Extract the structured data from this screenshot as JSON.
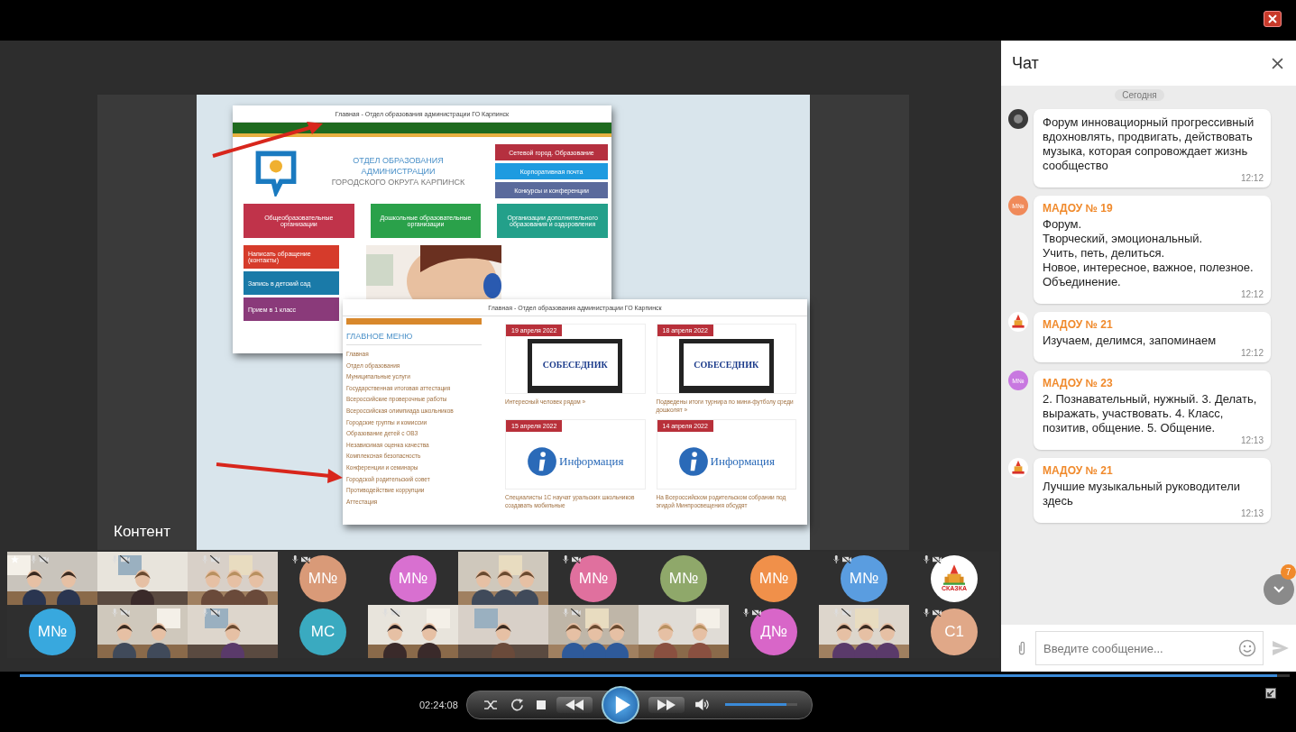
{
  "content_label": "Контент",
  "slide": {
    "back_window": {
      "title": "Главная - Отдел образования администрации ГО Карпинск",
      "heading": [
        "ОТДЕЛ ОБРАЗОВАНИЯ",
        "АДМИНИСТРАЦИИ",
        "ГОРОДСКОГО ОКРУГА КАРПИНСК"
      ],
      "side_links": [
        {
          "label": "Сетевой город. Образование",
          "color": "#b5303f"
        },
        {
          "label": "Корпоративная почта",
          "color": "#1e9be0"
        },
        {
          "label": "Конкурсы и конференции",
          "color": "#5a6a9c"
        }
      ],
      "tiles": [
        {
          "label": "Общеобразовательные организации",
          "color": "#c0334a"
        },
        {
          "label": "Дошкольные образовательные организации",
          "color": "#2aa14a"
        },
        {
          "label": "Организации дополнительного образования и оздоровления",
          "color": "#23a08a"
        }
      ],
      "left_links": [
        {
          "label": "Написать обращение (контакты)",
          "color": "#d63b2b"
        },
        {
          "label": "Запись в детский сад",
          "color": "#1a7aa8"
        },
        {
          "label": "Прием в 1 класс",
          "color": "#8a3a7a"
        }
      ]
    },
    "front_window": {
      "title": "Главная - Отдел образования администрации ГО Карпинск",
      "menu_title": "ГЛАВНОЕ МЕНЮ",
      "menu": [
        "Главная",
        "Отдел образования",
        "Муниципальные услуги",
        "Государственная итоговая аттестация",
        "Всероссийские проверочные работы",
        "Всероссийская олимпиада школьников",
        "Городские группы и комиссии",
        "Образование детей с ОВЗ",
        "Независимая оценка качества",
        "Комплексная безопасность",
        "Конференции и семинары",
        "Городской родительский совет",
        "Противодействие коррупции",
        "Аттестация"
      ],
      "news": [
        {
          "date": "19 апреля 2022",
          "kind": "sobesednik",
          "logo": "СОБЕСЕДНИК",
          "caption": "Интересный человек рядом »"
        },
        {
          "date": "18 апреля 2022",
          "kind": "sobesednik",
          "logo": "СОБЕСЕДНИК",
          "caption": "Подведены итоги турнира по мини-футболу среди дошколят »"
        },
        {
          "date": "15 апреля 2022",
          "kind": "info",
          "logo": "Информация",
          "caption": "Специалисты 1С научат уральских школьников создавать мобильные"
        },
        {
          "date": "14 апреля 2022",
          "kind": "info",
          "logo": "Информация",
          "caption": "На Всероссийском родительском собрании под эгидой Минпросвещения обсудят"
        }
      ]
    }
  },
  "participants": [
    {
      "kind": "video",
      "starred": true,
      "status_icons": true
    },
    {
      "kind": "video",
      "starred": false,
      "status_icons": true
    },
    {
      "kind": "video",
      "starred": false,
      "status_icons": true
    },
    {
      "kind": "avatar",
      "initials": "М№",
      "color": "#d99a78",
      "starred": false,
      "status_icons": true
    },
    {
      "kind": "avatar",
      "initials": "М№",
      "color": "#d870d0",
      "starred": false,
      "status_icons": false
    },
    {
      "kind": "video",
      "starred": false,
      "status_icons": false
    },
    {
      "kind": "avatar",
      "initials": "М№",
      "color": "#e0709e",
      "starred": false,
      "status_icons": true
    },
    {
      "kind": "avatar",
      "initials": "М№",
      "color": "#8fa86a",
      "starred": false,
      "status_icons": false
    },
    {
      "kind": "avatar",
      "initials": "М№",
      "color": "#f0904a",
      "starred": false,
      "status_icons": false
    },
    {
      "kind": "avatar",
      "initials": "М№",
      "color": "#5a9de0",
      "starred": false,
      "status_icons": true
    },
    {
      "kind": "logo",
      "logo_text": "СКАЗКА",
      "starred": false,
      "status_icons": true
    },
    {
      "kind": "avatar",
      "initials": "М№",
      "color": "#38a8de",
      "starred": false,
      "status_icons": false
    },
    {
      "kind": "video",
      "starred": false,
      "status_icons": true
    },
    {
      "kind": "video",
      "starred": false,
      "status_icons": true
    },
    {
      "kind": "avatar",
      "initials": "МС",
      "color": "#3aaac0",
      "starred": false,
      "status_icons": false
    },
    {
      "kind": "video",
      "starred": false,
      "status_icons": true
    },
    {
      "kind": "video",
      "starred": false,
      "status_icons": false
    },
    {
      "kind": "video",
      "starred": false,
      "status_icons": true
    },
    {
      "kind": "video",
      "starred": false,
      "status_icons": false
    },
    {
      "kind": "avatar",
      "initials": "Д№",
      "color": "#d866c8",
      "starred": false,
      "status_icons": true
    },
    {
      "kind": "video",
      "starred": false,
      "status_icons": true
    },
    {
      "kind": "avatar",
      "initials": "С1",
      "color": "#e0a888",
      "starred": false,
      "status_icons": true
    }
  ],
  "chat": {
    "title": "Чат",
    "date_chip": "Сегодня",
    "messages": [
      {
        "avatar": {
          "kind": "emblem"
        },
        "text": "Форум инновациорный прогрессивный вдохновлять, продвигать, действовать музыка, которая сопровождает жизнь сообщество",
        "time": "12:12"
      },
      {
        "avatar": {
          "kind": "initials",
          "initials": "М№",
          "color": "#f08a5a"
        },
        "sender": "МАДОУ № 19",
        "text": "Форум.\nТворческий, эмоциональный.\nУчить, петь, делиться.\nНовое, интересное, важное, полезное.\nОбъединение.",
        "time": "12:12"
      },
      {
        "avatar": {
          "kind": "logo"
        },
        "sender": "МАДОУ № 21",
        "text": "Изучаем, делимся, запоминаем",
        "time": "12:12"
      },
      {
        "avatar": {
          "kind": "initials",
          "initials": "М№",
          "color": "#c878e0"
        },
        "sender": "МАДОУ № 23",
        "text": "2. Познавательный, нужный. 3. Делать, выражать, участвовать. 4. Класс, позитив, общение. 5. Общение.",
        "time": "12:13"
      },
      {
        "avatar": {
          "kind": "logo"
        },
        "sender": "МАДОУ № 21",
        "text": "Лучшие музыкальный руководители здесь",
        "time": "12:13"
      }
    ],
    "unread_badge": "7",
    "input": {
      "placeholder": "Введите сообщение..."
    }
  },
  "player": {
    "time": "02:24:08",
    "seek": {
      "level": 0.99
    },
    "volume": {
      "level": 0.85
    }
  }
}
